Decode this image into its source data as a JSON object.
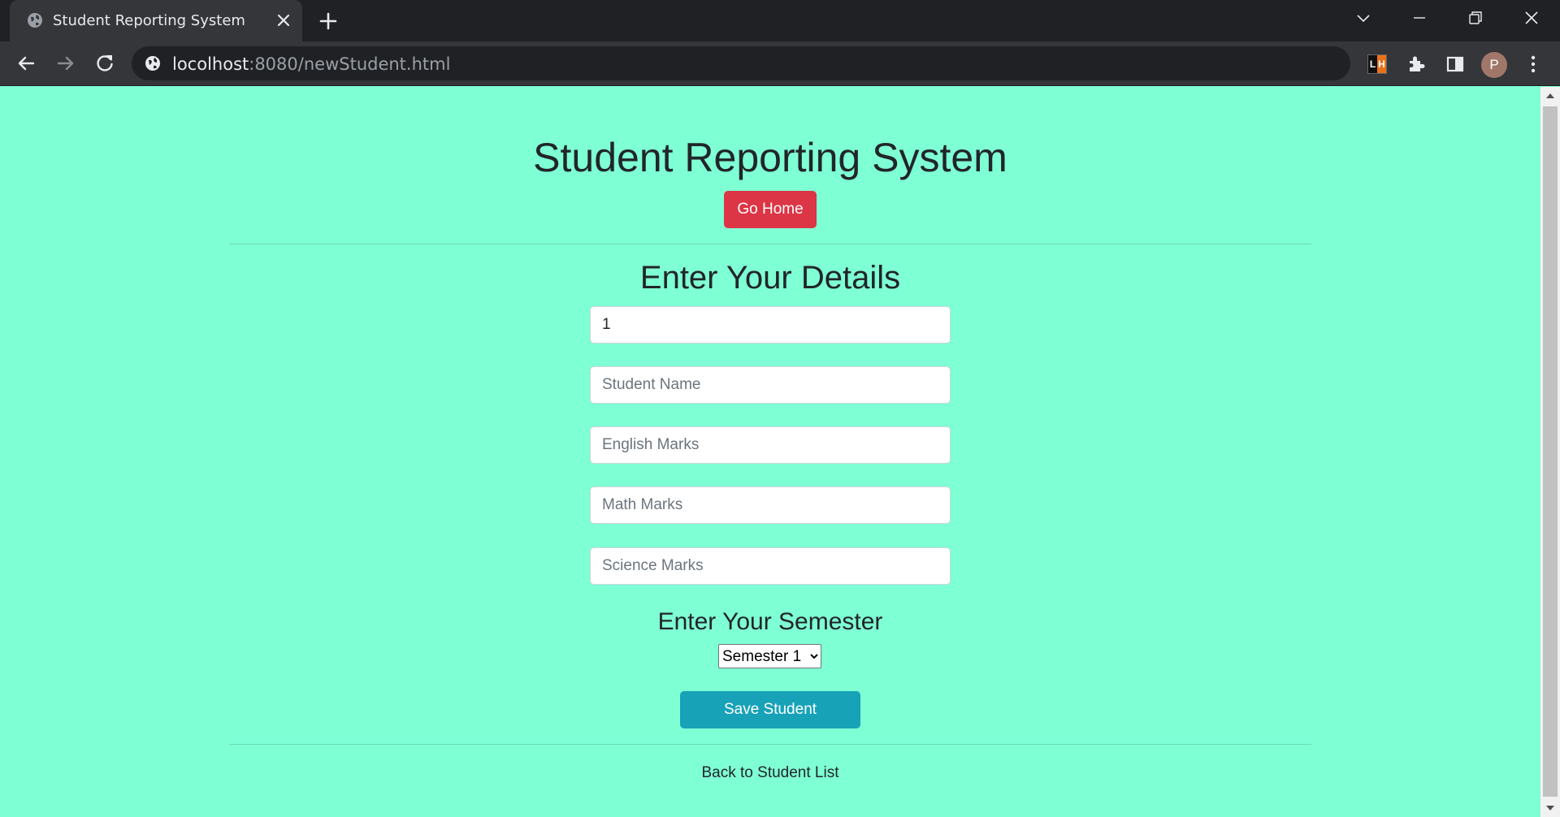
{
  "browser": {
    "tab": {
      "title": "Student Reporting System"
    },
    "url": {
      "host": "locolhost",
      "rest": ":8080/newStudent.html"
    },
    "extension_lh": {
      "left": "L",
      "right": "H"
    },
    "profile_initial": "P"
  },
  "page": {
    "title": "Student Reporting System",
    "go_home_label": "Go Home",
    "section_title": "Enter Your Details",
    "fields": {
      "id": {
        "value": "1",
        "placeholder": ""
      },
      "name": {
        "placeholder": "Student Name"
      },
      "english": {
        "placeholder": "English Marks"
      },
      "math": {
        "placeholder": "Math Marks"
      },
      "science": {
        "placeholder": "Science Marks"
      }
    },
    "semester_title": "Enter Your Semester",
    "semester_selected": "Semester 1",
    "save_label": "Save Student",
    "back_link": "Back to Student List"
  },
  "colors": {
    "page_background": "#7fffd4",
    "go_home_button": "#dc3545",
    "save_button": "#17a2b8"
  }
}
